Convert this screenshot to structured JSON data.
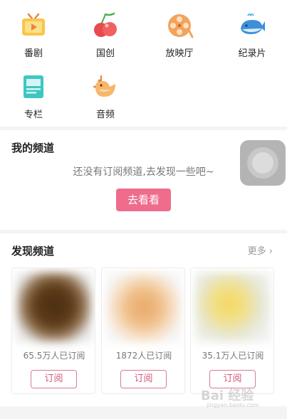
{
  "categories": [
    {
      "label": "番剧",
      "icon": "tv-icon"
    },
    {
      "label": "国创",
      "icon": "cherry-icon"
    },
    {
      "label": "放映厅",
      "icon": "film-reel-icon"
    },
    {
      "label": "纪录片",
      "icon": "whale-icon"
    },
    {
      "label": "专栏",
      "icon": "article-icon"
    },
    {
      "label": "音频",
      "icon": "bird-icon"
    }
  ],
  "my_channels": {
    "title": "我的频道",
    "empty_text": "还没有订阅频道,去发现一些吧~",
    "go_label": "去看看"
  },
  "discover": {
    "title": "发现频道",
    "more_label": "更多 ›",
    "cards": [
      {
        "count": "65.5万人已订阅",
        "sub_label": "订阅"
      },
      {
        "count": "1872人已订阅",
        "sub_label": "订阅"
      },
      {
        "count": "35.1万人已订阅",
        "sub_label": "订阅"
      }
    ]
  },
  "watermark": {
    "text": "Bai 经验",
    "sub": "jingyan.baidu.com"
  },
  "colors": {
    "accent": "#ef6c8c",
    "outline": "#d87b93"
  }
}
